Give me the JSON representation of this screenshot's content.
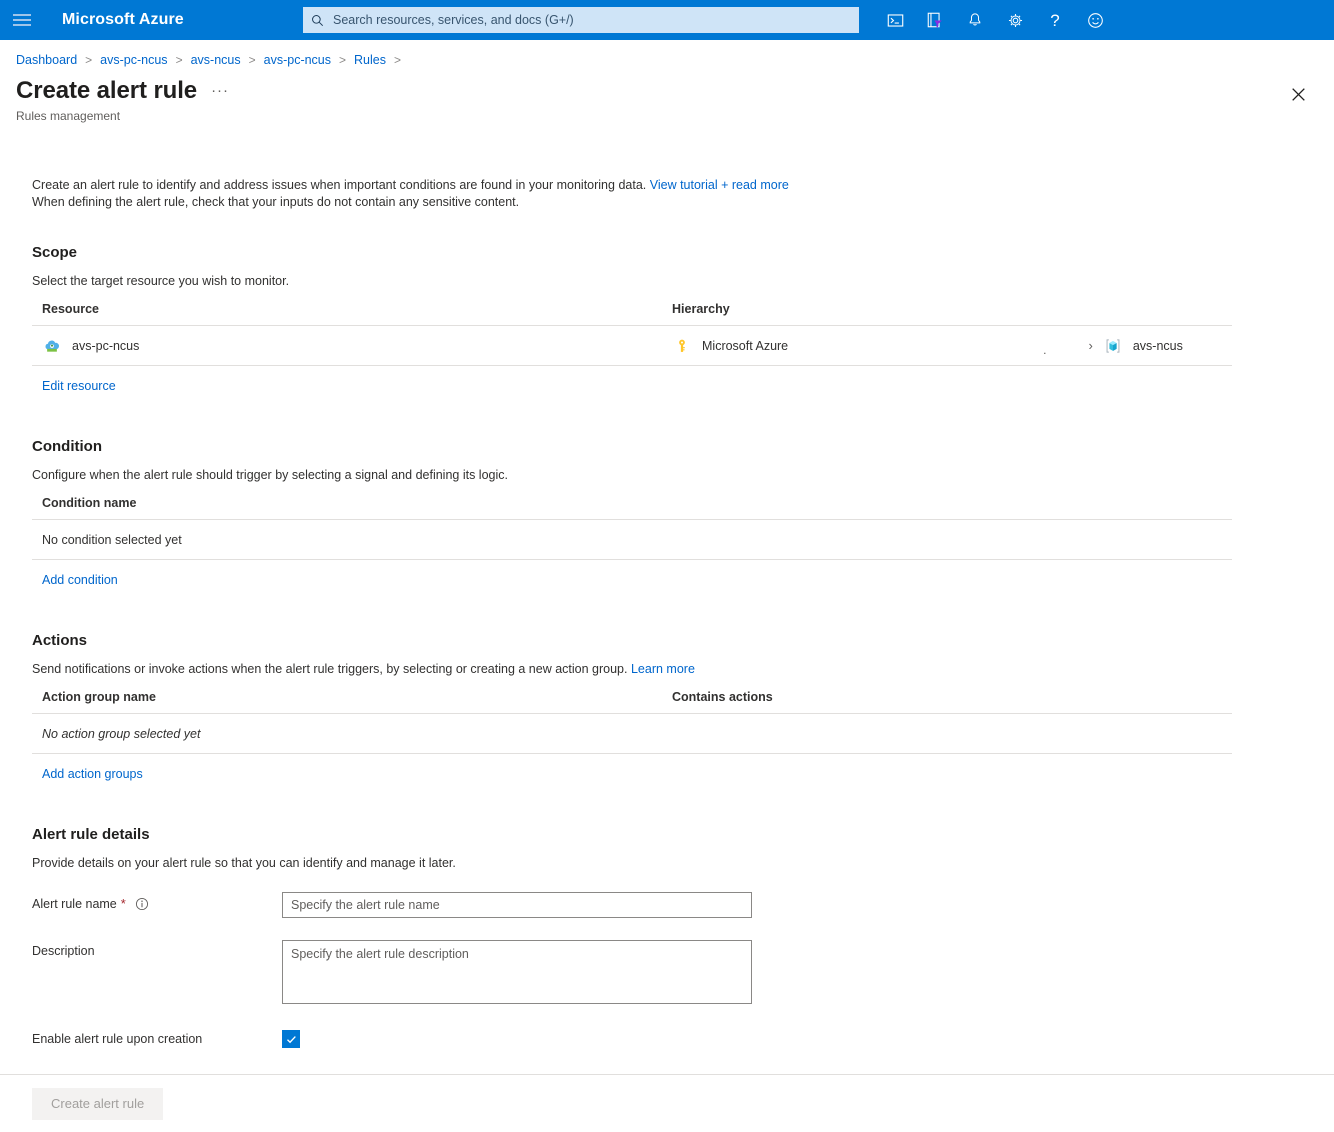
{
  "topbar": {
    "menu_icon": "hamburger-icon",
    "brand": "Microsoft Azure",
    "search_placeholder": "Search resources, services, and docs (G+/)",
    "search_value": "",
    "icons": [
      {
        "name": "cloud-shell-icon",
        "title": "Cloud Shell"
      },
      {
        "name": "directories-subscriptions-icon",
        "title": "Directories + subscriptions"
      },
      {
        "name": "notifications-bell-icon",
        "title": "Notifications"
      },
      {
        "name": "settings-gear-icon",
        "title": "Settings"
      },
      {
        "name": "help-question-icon",
        "title": "Help"
      },
      {
        "name": "feedback-smiley-icon",
        "title": "Feedback"
      }
    ]
  },
  "breadcrumb": {
    "items": [
      "Dashboard",
      "avs-pc-ncus",
      "avs-ncus",
      "avs-pc-ncus",
      "Rules"
    ],
    "separator": ">"
  },
  "header": {
    "title": "Create alert rule",
    "ellipsis": "···",
    "subtitle": "Rules management",
    "close_icon": "close-icon"
  },
  "intro": {
    "line1": "Create an alert rule to identify and address issues when important conditions are found in your monitoring data.",
    "line1_link": "View tutorial + read more",
    "line2": "When defining the alert rule, check that your inputs do not contain any sensitive content."
  },
  "scope": {
    "heading": "Scope",
    "description": "Select the target resource you wish to monitor.",
    "columns": {
      "resource": "Resource",
      "hierarchy": "Hierarchy"
    },
    "row": {
      "resource_icon": "avs-private-cloud-icon",
      "resource_name": "avs-pc-ncus",
      "hierarchy_icon": "subscription-key-icon",
      "hierarchy_name": "Microsoft Azure",
      "hierarchy_dot": ".",
      "hierarchy_chevron": "›",
      "hierarchy_child_icon": "resource-group-icon",
      "hierarchy_child_name": "avs-ncus"
    },
    "edit_link": "Edit resource"
  },
  "condition": {
    "heading": "Condition",
    "description": "Configure when the alert rule should trigger by selecting a signal and defining its logic.",
    "column": "Condition name",
    "empty": "No condition selected yet",
    "add_link": "Add condition"
  },
  "actions": {
    "heading": "Actions",
    "description": "Send notifications or invoke actions when the alert rule triggers, by selecting or creating a new action group.",
    "description_link": "Learn more",
    "columns": {
      "name": "Action group name",
      "contains": "Contains actions"
    },
    "empty": "No action group selected yet",
    "add_link": "Add action groups"
  },
  "details": {
    "heading": "Alert rule details",
    "description": "Provide details on your alert rule so that you can identify and manage it later.",
    "name_label": "Alert rule name",
    "name_required": "*",
    "name_info_icon": "info-icon",
    "name_placeholder": "Specify the alert rule name",
    "name_value": "",
    "description_label": "Description",
    "description_placeholder": "Specify the alert rule description",
    "description_value": "",
    "enable_label": "Enable alert rule upon creation",
    "enable_checked": true,
    "check_icon": "checkmark-icon"
  },
  "footer": {
    "submit_label": "Create alert rule",
    "submit_disabled": true
  },
  "colors": {
    "brand_blue": "#0078d4",
    "link_blue": "#0066cc",
    "required_red": "#a4262c",
    "border_gray": "#e1dfdd",
    "disabled_bg": "#f3f2f1"
  }
}
